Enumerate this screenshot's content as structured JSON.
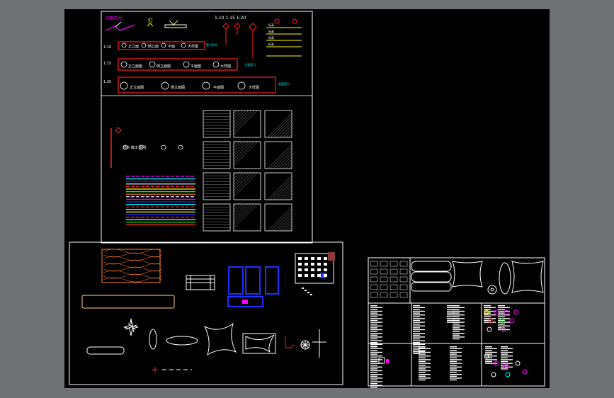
{
  "colors": {
    "background": "#6f7173",
    "canvas": "#000000",
    "frame": "#ffffff",
    "red": "#ff2020",
    "yellow": "#ffff00",
    "cyan": "#00ffff",
    "blue": "#2030ff",
    "magenta": "#ff00ff",
    "orange": "#ff7f27",
    "green": "#00ff00"
  },
  "legend": {
    "title": "详图符号",
    "lamp_label": "灯",
    "scales": "1:10  1:15  1:20",
    "scale_1_10": "1:10",
    "scale_1_15": "1:15",
    "scale_1_20": "1:20",
    "row_a": [
      "正立面",
      "侧立面",
      "平面",
      "大样图"
    ],
    "row_b": [
      "正立面图",
      "侧立面图",
      "平面图",
      "大样图"
    ],
    "row_c": [
      "正立面图",
      "侧立面图",
      "平面图",
      "大样图"
    ],
    "row_tags": [
      "索引符号",
      "立面索引",
      "剖面索引"
    ],
    "side_labels": [
      "标高",
      "标高",
      "标高",
      "标高"
    ]
  },
  "hatch_panel": {
    "legend_text": "材料 做法 说明"
  }
}
